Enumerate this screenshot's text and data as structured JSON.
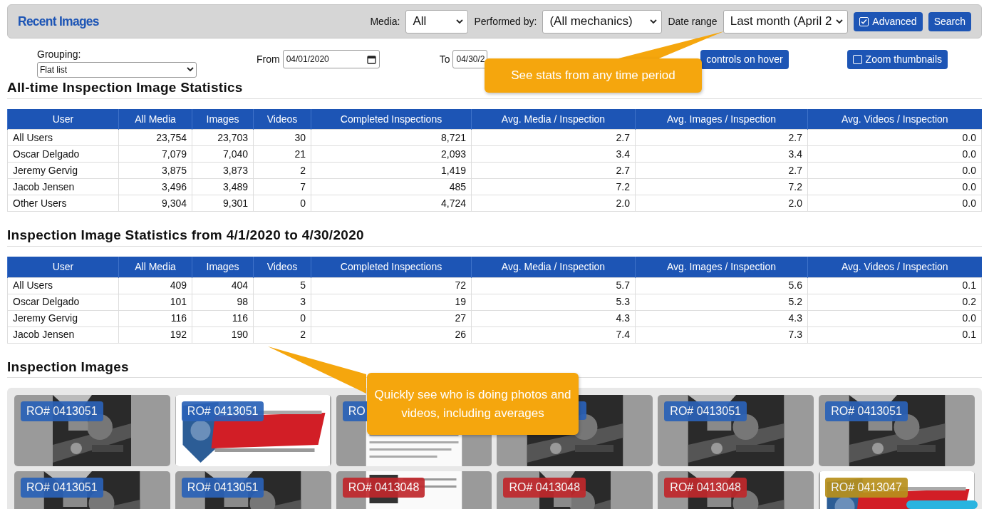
{
  "header": {
    "title": "Recent Images",
    "media_label": "Media:",
    "media": "All",
    "performed_label": "Performed by:",
    "performed_by": "(All mechanics)",
    "date_label": "Date range",
    "date_range": "Last month (April 2",
    "advanced": {
      "label": "Advanced",
      "checked": true
    },
    "search": "Search"
  },
  "options": {
    "grouping_label": "Grouping:",
    "grouping": "Flat list",
    "from_label": "From",
    "from": "04/01/2020",
    "to_label": "To",
    "to": "04/30/2",
    "hover": {
      "label": "controls on hover"
    },
    "zoom": {
      "label": "Zoom thumbnails",
      "checked": false
    }
  },
  "callouts": [
    "See stats from any time period",
    "Quickly see who is doing photos and videos, including averages"
  ],
  "tables": [
    {
      "title": "All-time Inspection Image Statistics",
      "columns": [
        "User",
        "All Media",
        "Images",
        "Videos",
        "Completed Inspections",
        "Avg. Media / Inspection",
        "Avg. Images / Inspection",
        "Avg. Videos / Inspection"
      ],
      "rows": [
        [
          "All Users",
          "23,754",
          "23,703",
          "30",
          "8,721",
          "2.7",
          "2.7",
          "0.0"
        ],
        [
          "Oscar Delgado",
          "7,079",
          "7,040",
          "21",
          "2,093",
          "3.4",
          "3.4",
          "0.0"
        ],
        [
          "Jeremy Gervig",
          "3,875",
          "3,873",
          "2",
          "1,419",
          "2.7",
          "2.7",
          "0.0"
        ],
        [
          "Jacob Jensen",
          "3,496",
          "3,489",
          "7",
          "485",
          "7.2",
          "7.2",
          "0.0"
        ],
        [
          "Other Users",
          "9,304",
          "9,301",
          "0",
          "4,724",
          "2.0",
          "2.0",
          "0.0"
        ]
      ]
    },
    {
      "title": "Inspection Image Statistics from 4/1/2020 to 4/30/2020",
      "columns": [
        "User",
        "All Media",
        "Images",
        "Videos",
        "Completed Inspections",
        "Avg. Media / Inspection",
        "Avg. Images / Inspection",
        "Avg. Videos / Inspection"
      ],
      "rows": [
        [
          "All Users",
          "409",
          "404",
          "5",
          "72",
          "5.7",
          "5.6",
          "0.1"
        ],
        [
          "Oscar Delgado",
          "101",
          "98",
          "3",
          "19",
          "5.3",
          "5.2",
          "0.2"
        ],
        [
          "Jeremy Gervig",
          "116",
          "116",
          "0",
          "27",
          "4.3",
          "4.3",
          "0.0"
        ],
        [
          "Jacob Jensen",
          "192",
          "190",
          "2",
          "26",
          "7.4",
          "7.3",
          "0.1"
        ]
      ]
    }
  ],
  "images_title": "Inspection Images",
  "tiles": [
    {
      "ro": "RO# 0413051",
      "color": "#2a62b8"
    },
    {
      "ro": "RO# 0413051",
      "color": "#2a62b8"
    },
    {
      "ro": "RO",
      "color": "#2a62b8"
    },
    {
      "color": "#2a62b8"
    },
    {
      "ro": "RO# 0413051",
      "color": "#2a62b8"
    },
    {
      "ro": "RO# 0413051",
      "color": "#2a62b8"
    },
    {
      "ro": "RO# 0413051",
      "color": "#2a62b8"
    },
    {
      "ro": "RO# 0413051",
      "color": "#2a62b8"
    },
    {
      "ro": "RO# 0413048",
      "color": "#c0282c"
    },
    {
      "ro": "RO# 0413048",
      "color": "#c0282c"
    },
    {
      "ro": "RO# 0413048",
      "color": "#c0282c"
    },
    {
      "ro": "RO# 0413047",
      "color": "#b8901c"
    }
  ]
}
